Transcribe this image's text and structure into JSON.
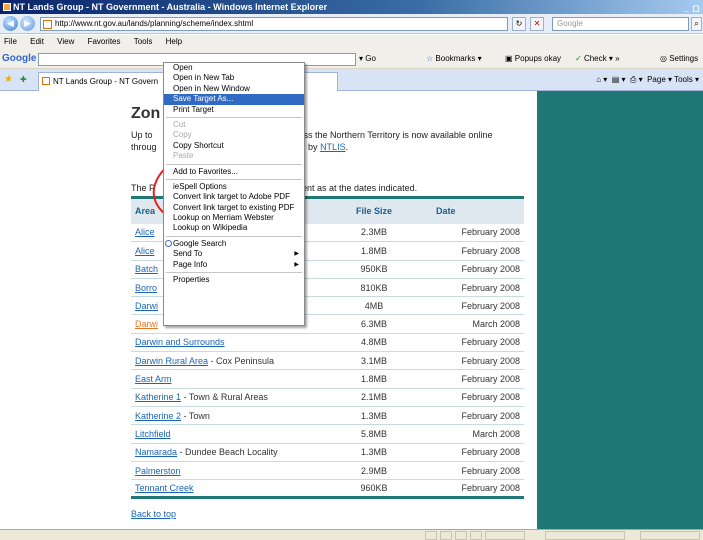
{
  "window": {
    "title": "NT Lands Group - NT Government - Australia - Windows Internet Explorer",
    "controls": [
      "_",
      "◻"
    ]
  },
  "address_bar": {
    "url": "http://www.nt.gov.au/lands/planning/scheme/index.shtml",
    "search_placeholder": "Google",
    "back_label": "◀",
    "forward_label": "▶",
    "refresh_label": "↻",
    "stop_label": "✕"
  },
  "menubar": {
    "items": [
      "File",
      "Edit",
      "View",
      "Favorites",
      "Tools",
      "Help"
    ]
  },
  "google_toolbar": {
    "logo": "Google",
    "go_label": "Go",
    "bookmarks": "Bookmarks",
    "popups": "Popups okay",
    "check": "Check",
    "more": "»",
    "settings": "Settings"
  },
  "tab": {
    "label": "NT Lands Group - NT Govern",
    "right_tools": "Page ▾  Tools ▾"
  },
  "page": {
    "title": "Zon",
    "intro_left_1": "Up to",
    "intro_left_2": "throug",
    "intro_right_1": "oss the Northern Territory is now available online",
    "intro_right_2": "d by",
    "intro_link": "NTLIS",
    "intro_end": ".",
    "table_lead_left": "The P",
    "table_lead_right": "ent as at the dates indicated.",
    "headers": {
      "area": "Area",
      "size": "File Size",
      "date": "Date"
    },
    "rows": [
      {
        "link": "Alice",
        "suffix": "",
        "size": "2.3MB",
        "date": "February 2008"
      },
      {
        "link": "Alice",
        "suffix": "",
        "size": "1.8MB",
        "date": "February 2008"
      },
      {
        "link": "Batch",
        "suffix": "",
        "size": "950KB",
        "date": "February 2008"
      },
      {
        "link": "Borro",
        "suffix": "",
        "size": "810KB",
        "date": "February 2008"
      },
      {
        "link": "Darwi",
        "suffix": "",
        "size": "4MB",
        "date": "February 2008"
      },
      {
        "link": "Darwi",
        "suffix": "",
        "size": "6.3MB",
        "date": "March 2008"
      },
      {
        "link": "Darwin and Surrounds",
        "suffix": "",
        "size": "4.8MB",
        "date": "February 2008"
      },
      {
        "link": "Darwin Rural Area",
        "suffix": " - Cox Peninsula",
        "size": "3.1MB",
        "date": "February 2008"
      },
      {
        "link": "East Arm",
        "suffix": "",
        "size": "1.8MB",
        "date": "February 2008"
      },
      {
        "link": "Katherine 1",
        "suffix": " - Town & Rural Areas",
        "size": "2.1MB",
        "date": "February 2008"
      },
      {
        "link": "Katherine 2",
        "suffix": " - Town",
        "size": "1.3MB",
        "date": "February 2008"
      },
      {
        "link": "Litchfield",
        "suffix": "",
        "size": "5.8MB",
        "date": "March 2008"
      },
      {
        "link": "Namarada",
        "suffix": " - Dundee Beach Locality",
        "size": "1.3MB",
        "date": "February 2008"
      },
      {
        "link": "Palmerston",
        "suffix": "",
        "size": "2.9MB",
        "date": "February 2008"
      },
      {
        "link": "Tennant Creek",
        "suffix": "",
        "size": "960KB",
        "date": "February 2008"
      }
    ],
    "back_to_top": "Back to top"
  },
  "context_menu": {
    "groups": [
      [
        "Open",
        "Open in New Tab",
        "Open in New Window",
        "Save Target As...",
        "Print Target"
      ],
      [
        "Cut",
        "Copy",
        "Copy Shortcut",
        "Paste"
      ],
      [
        "Add to Favorites..."
      ],
      [
        "ieSpell Options",
        "Convert link target to Adobe PDF",
        "Convert link target to existing PDF",
        "Lookup on Merriam Webster",
        "Lookup on Wikipedia"
      ],
      [
        "Google Search",
        "Send To",
        "Page Info"
      ],
      [
        "Properties"
      ]
    ],
    "selected": "Save Target As...",
    "disabled": [
      "Cut",
      "Copy",
      "Paste"
    ],
    "submenu": [
      "Send To",
      "Page Info"
    ]
  },
  "colors": {
    "accent_teal": "#1f7776",
    "link": "#1a66b5",
    "visited_link": "#e87722",
    "highlight_circle": "#e52222",
    "menu_selection": "#316ac5"
  }
}
